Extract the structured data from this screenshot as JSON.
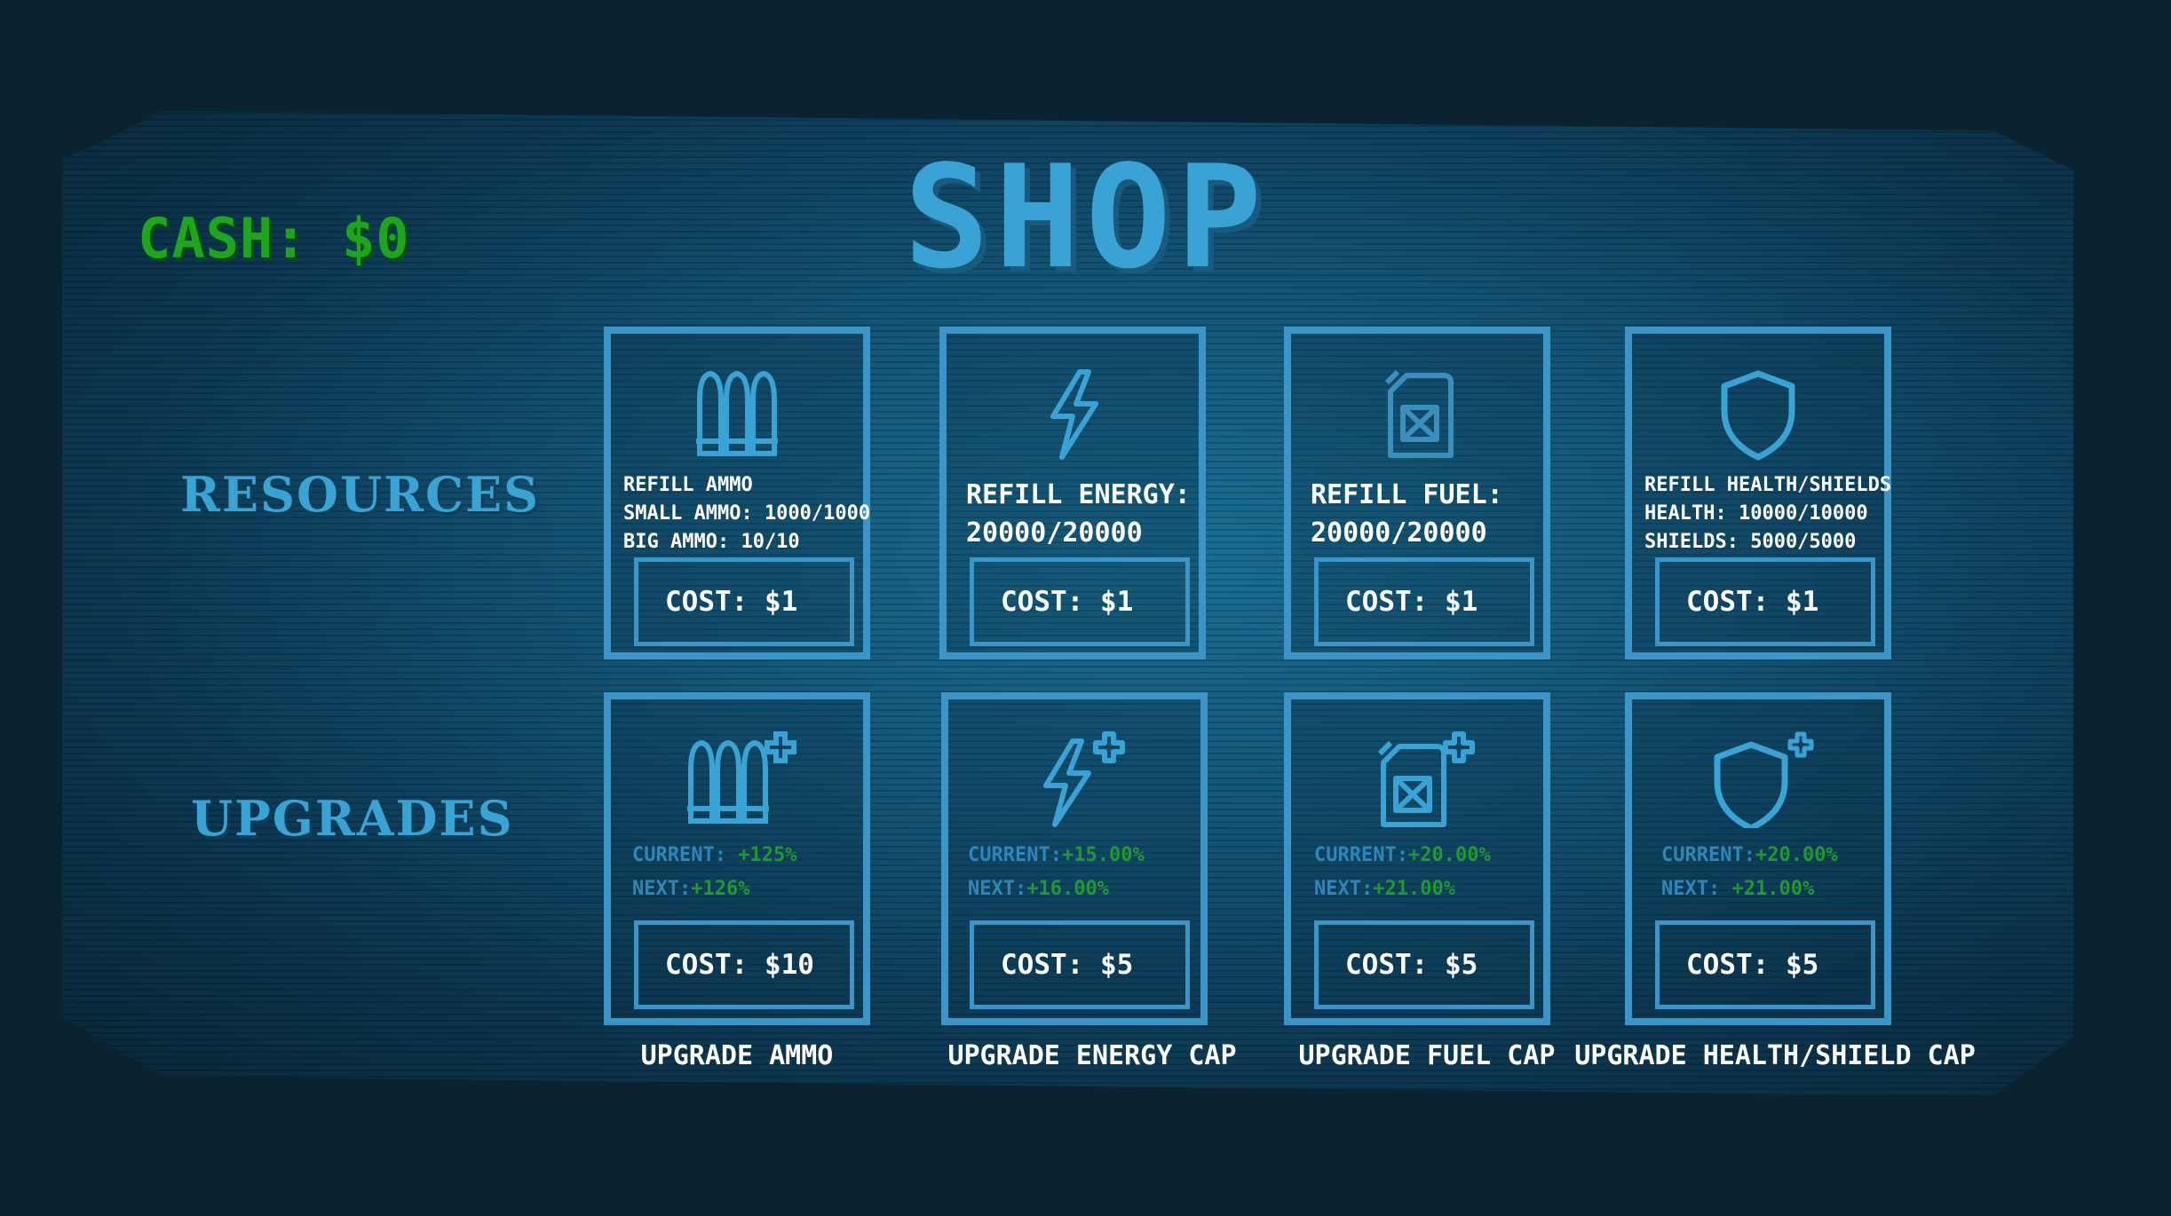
{
  "title": "SHOP",
  "cash": "CASH: $0",
  "rows": {
    "resources": "RESOURCES",
    "upgrades": "UPGRADES"
  },
  "resources": [
    {
      "icon": "ammo-icon",
      "lines": [
        "REFILL AMMO",
        "SMALL AMMO: 1000/1000",
        "BIG AMMO: 10/10"
      ],
      "cost": "COST: $1"
    },
    {
      "icon": "energy-icon",
      "lines": [
        "REFILL ENERGY:",
        "20000/20000"
      ],
      "cost": "COST: $1"
    },
    {
      "icon": "fuel-icon",
      "lines": [
        "REFILL FUEL:",
        "20000/20000"
      ],
      "cost": "COST: $1"
    },
    {
      "icon": "shield-icon",
      "lines": [
        "REFILL HEALTH/SHIELDS",
        "HEALTH: 10000/10000",
        "SHIELDS: 5000/5000"
      ],
      "cost": "COST: $1"
    }
  ],
  "upgrades": [
    {
      "icon": "ammo-plus-icon",
      "current_label": "CURRENT:",
      "current": "+125%",
      "next_label": "NEXT:",
      "next": "+126%",
      "cost": "COST: $10",
      "name": "UPGRADE AMMO"
    },
    {
      "icon": "energy-plus-icon",
      "current_label": "CURRENT:",
      "current": "+15.00%",
      "next_label": "NEXT:",
      "next": "+16.00%",
      "cost": "COST: $5",
      "name": "UPGRADE ENERGY CAP"
    },
    {
      "icon": "fuel-plus-icon",
      "current_label": "CURRENT:",
      "current": "+20.00%",
      "next_label": "NEXT:",
      "next": "+21.00%",
      "cost": "COST: $5",
      "name": "UPGRADE FUEL CAP"
    },
    {
      "icon": "shield-plus-icon",
      "current_label": "CURRENT:",
      "current": "+20.00%",
      "next_label": "NEXT:",
      "next": "+21.00%",
      "cost": "COST: $5",
      "name": "UPGRADE HEALTH/SHIELD CAP"
    }
  ],
  "colors": {
    "accent": "#3b95c8",
    "cash": "#1ea51e",
    "value": "#1f9a2d"
  }
}
